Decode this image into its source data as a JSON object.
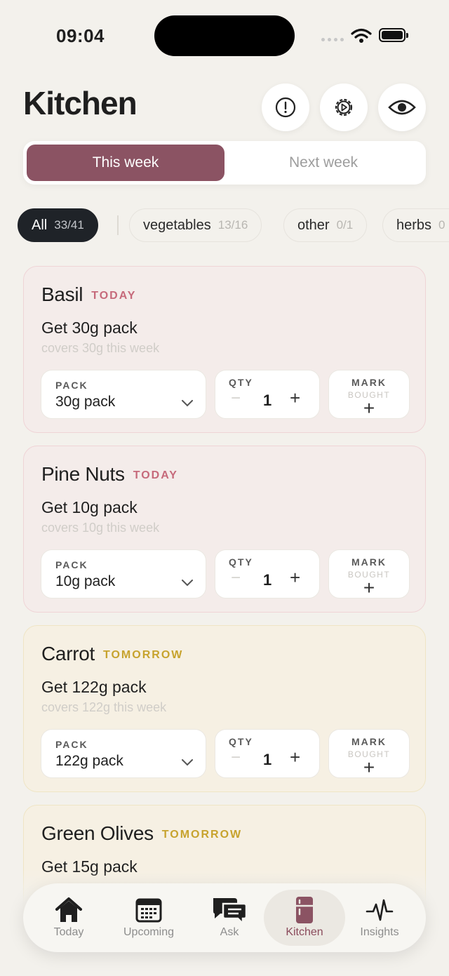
{
  "status": {
    "time": "09:04"
  },
  "header": {
    "title": "Kitchen"
  },
  "week_tabs": {
    "active": "This week",
    "inactive": "Next week"
  },
  "filters": [
    {
      "label": "All",
      "count": "33/41"
    },
    {
      "label": "vegetables",
      "count": "13/16"
    },
    {
      "label": "other",
      "count": "0/1"
    },
    {
      "label": "herbs",
      "count": "0"
    }
  ],
  "control_labels": {
    "pack": "PACK",
    "qty": "QTY",
    "mark": "MARK",
    "bought": "BOUGHT",
    "minus": "−",
    "plus": "+"
  },
  "items": [
    {
      "name": "Basil",
      "when": "TODAY",
      "action": "Get 30g pack",
      "covers": "covers 30g this week",
      "pack": "30g pack",
      "qty": "1"
    },
    {
      "name": "Pine Nuts",
      "when": "TODAY",
      "action": "Get 10g pack",
      "covers": "covers 10g this week",
      "pack": "10g pack",
      "qty": "1"
    },
    {
      "name": "Carrot",
      "when": "TOMORROW",
      "action": "Get 122g pack",
      "covers": "covers 122g this week",
      "pack": "122g pack",
      "qty": "1"
    },
    {
      "name": "Green Olives",
      "when": "TOMORROW",
      "action": "Get 15g pack"
    }
  ],
  "tabbar": [
    {
      "label": "Today",
      "icon": "home-icon"
    },
    {
      "label": "Upcoming",
      "icon": "calendar-icon"
    },
    {
      "label": "Ask",
      "icon": "chat-icon"
    },
    {
      "label": "Kitchen",
      "icon": "fridge-icon",
      "active": true
    },
    {
      "label": "Insights",
      "icon": "pulse-icon"
    }
  ],
  "colors": {
    "accent": "#8b5363",
    "today": "#c66a7b",
    "tomorrow": "#c7a32e",
    "background": "#f3f1ec"
  }
}
